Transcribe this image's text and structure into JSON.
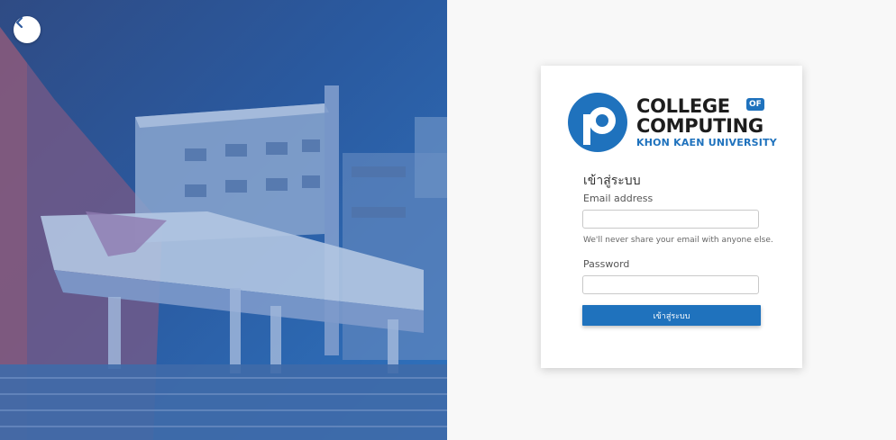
{
  "hero": {
    "back_button_icon": "chevron-left-icon",
    "overlay_colors": [
      "#2f4b84",
      "#2f73bf"
    ]
  },
  "logo": {
    "line1": "COLLEGE",
    "badge": "OF",
    "line2": "COMPUTING",
    "line3": "KHON KAEN UNIVERSITY",
    "brand_color": "#1f72bd"
  },
  "form": {
    "title": "เข้าสู่ระบบ",
    "email_label": "Email address",
    "email_value": "",
    "email_help": "We'll never share your email with anyone else.",
    "password_label": "Password",
    "password_value": "",
    "submit_label": "เข้าสู่ระบบ"
  }
}
